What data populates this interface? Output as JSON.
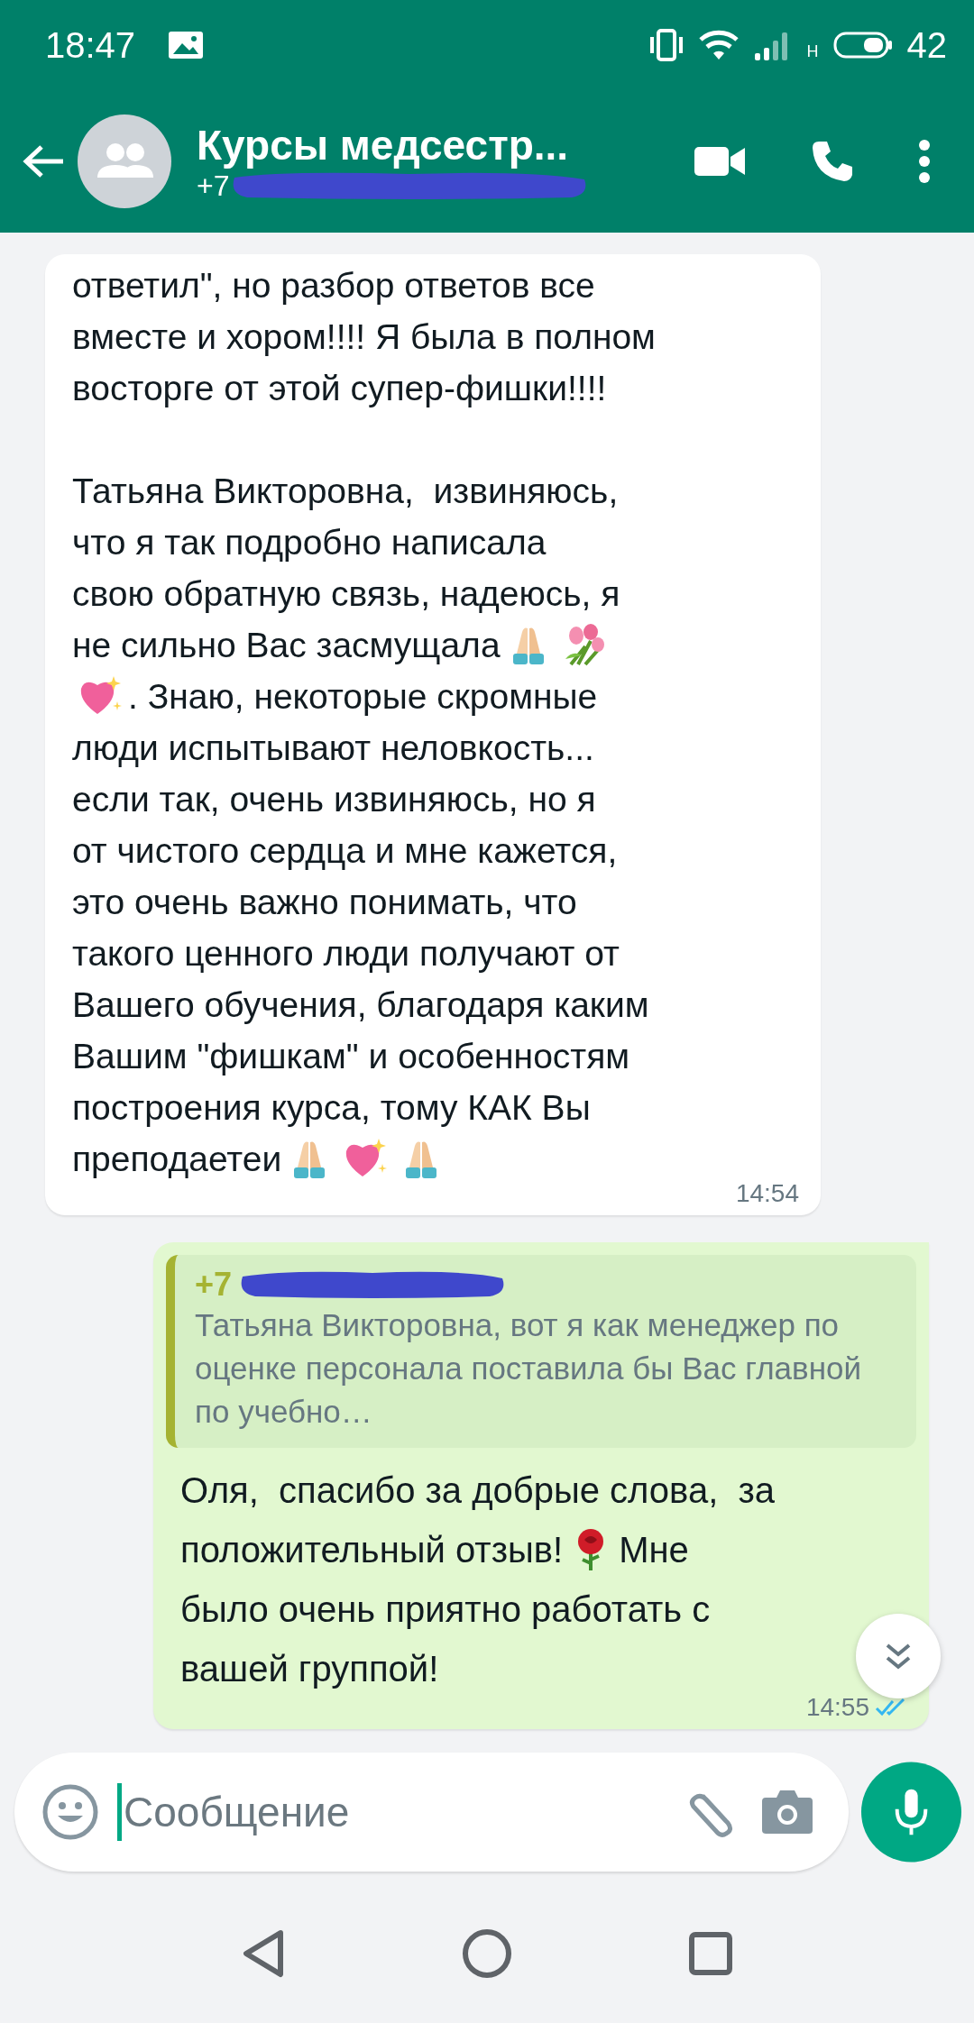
{
  "status_bar": {
    "time": "18:47",
    "network": "H",
    "battery": "42"
  },
  "header": {
    "title": "Курсы медсестр...",
    "subtitle": "+7"
  },
  "messages": [
    {
      "kind": "incoming",
      "time": "14:54",
      "paragraphs": [
        [
          [
            {
              "kind": "text",
              "text": "ответил\", но разбор ответов все"
            }
          ],
          [
            {
              "kind": "text",
              "text": "вместе и хором!!!! Я была в полном"
            }
          ],
          [
            {
              "kind": "text",
              "text": "восторге от этой супер-фишки!!!!"
            }
          ]
        ],
        [
          [
            {
              "kind": "text",
              "text": "Татьяна Викторовна,  извиняюсь,"
            }
          ],
          [
            {
              "kind": "text",
              "text": "что я так подробно написала"
            }
          ],
          [
            {
              "kind": "text",
              "text": "свою обратную связь, надеюсь, я"
            }
          ],
          [
            {
              "kind": "text",
              "text": "не сильно Вас засмущала"
            },
            {
              "kind": "pray"
            },
            {
              "kind": "tulips"
            }
          ],
          [
            {
              "kind": "heart"
            },
            {
              "kind": "text",
              "text": ". Знаю, некоторые скромные"
            }
          ],
          [
            {
              "kind": "text",
              "text": "люди испытывают неловкость..."
            }
          ],
          [
            {
              "kind": "text",
              "text": "если так, очень извиняюсь, но я"
            }
          ],
          [
            {
              "kind": "text",
              "text": "от чистого сердца и мне кажется,"
            }
          ],
          [
            {
              "kind": "text",
              "text": "это очень важно понимать, что"
            }
          ],
          [
            {
              "kind": "text",
              "text": "такого ценного люди получают от"
            }
          ],
          [
            {
              "kind": "text",
              "text": "Вашего обучения, благодаря каким"
            }
          ],
          [
            {
              "kind": "text",
              "text": "Вашим \"фишкам\" и особенностям"
            }
          ],
          [
            {
              "kind": "text",
              "text": "построения курса, тому КАК Вы"
            }
          ],
          [
            {
              "kind": "text",
              "text": "преподаетеи"
            },
            {
              "kind": "pray"
            },
            {
              "kind": "heart"
            },
            {
              "kind": "pray"
            }
          ]
        ]
      ]
    },
    {
      "kind": "outgoing",
      "time": "14:55",
      "read": true,
      "quote": {
        "author": "+7",
        "text": "Татьяна Викторовна, вот я как менеджер по оценке персонала поставила бы Вас главной по учебно…"
      },
      "paragraphs": [
        [
          [
            {
              "kind": "text",
              "text": "Оля,  спасибо за добрые слова,  за"
            }
          ],
          [
            {
              "kind": "text",
              "text": "положительный отзыв!"
            },
            {
              "kind": "rose"
            },
            {
              "kind": "text",
              "text": "Мне"
            }
          ],
          [
            {
              "kind": "text",
              "text": "было очень приятно работать с"
            }
          ],
          [
            {
              "kind": "text",
              "text": "вашей группой!"
            }
          ]
        ]
      ]
    }
  ],
  "composer": {
    "placeholder": "Сообщение"
  }
}
